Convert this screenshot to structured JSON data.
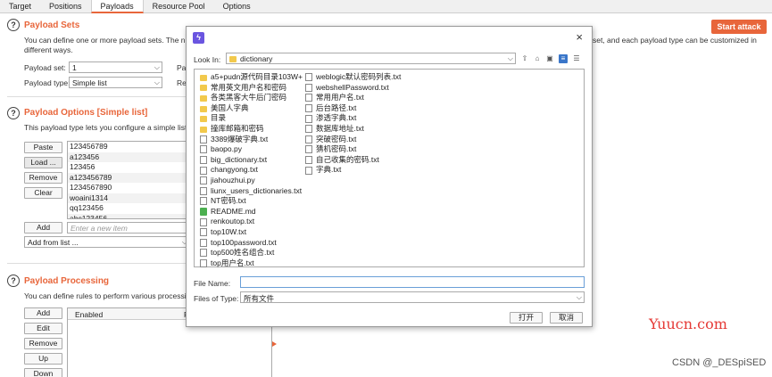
{
  "tabs": [
    "Target",
    "Positions",
    "Payloads",
    "Resource Pool",
    "Options"
  ],
  "payload_sets": {
    "title": "Payload Sets",
    "desc_line1": "You can define one or more payload sets. The numb",
    "desc_line2": "different ways.",
    "desc_right": "set, and each payload type can be customized in",
    "start_label": "Start attack",
    "set_label": "Payload set:",
    "set_value": "1",
    "type_label": "Payload type:",
    "type_value": "Simple list",
    "right_label_1": "Pay",
    "right_label_2": "Rec"
  },
  "payload_options": {
    "title": "Payload Options [Simple list]",
    "desc": "This payload type lets you configure a simple list of",
    "buttons": [
      "Paste",
      "Load ...",
      "Remove",
      "Clear"
    ],
    "items": [
      "123456789",
      "a123456",
      "123456",
      "a123456789",
      "1234567890",
      "woaini1314",
      "qq123456",
      "abc123456"
    ],
    "add_label": "Add",
    "add_placeholder": "Enter a new item",
    "add_from_list": "Add from list ..."
  },
  "payload_processing": {
    "title": "Payload Processing",
    "desc": "You can define rules to perform various processing",
    "buttons": [
      "Add",
      "Edit",
      "Remove",
      "Up",
      "Down"
    ],
    "col_enabled": "Enabled",
    "col_rule": "R"
  },
  "dialog": {
    "look_in_label": "Look In:",
    "look_in_value": "dictionary",
    "close_glyph": "×",
    "logo_glyph": "ϟ",
    "files_col1": [
      {
        "name": "a5+pudn源代码目录103W+",
        "icon": "folder"
      },
      {
        "name": "常用英文用户名和密码",
        "icon": "folder"
      },
      {
        "name": "各类黑客大牛后门密码",
        "icon": "folder"
      },
      {
        "name": "美国人字典",
        "icon": "folder"
      },
      {
        "name": "目录",
        "icon": "folder"
      },
      {
        "name": "撞库邮箱和密码",
        "icon": "folder"
      },
      {
        "name": "3389爆破字典.txt",
        "icon": "file"
      },
      {
        "name": "baopo.py",
        "icon": "file"
      },
      {
        "name": "big_dictionary.txt",
        "icon": "file"
      },
      {
        "name": "changyong.txt",
        "icon": "file"
      },
      {
        "name": "jiahouzhui.py",
        "icon": "file"
      },
      {
        "name": "liunx_users_dictionaries.txt",
        "icon": "file"
      },
      {
        "name": "NT密码.txt",
        "icon": "file"
      },
      {
        "name": "README.md",
        "icon": "md"
      },
      {
        "name": "renkoutop.txt",
        "icon": "file"
      },
      {
        "name": "top10W.txt",
        "icon": "file"
      },
      {
        "name": "top100password.txt",
        "icon": "file"
      },
      {
        "name": "top500姓名组合.txt",
        "icon": "file"
      },
      {
        "name": "top用户名.txt",
        "icon": "file"
      }
    ],
    "files_col2": [
      {
        "name": "weblogic默认密码列表.txt",
        "icon": "file"
      },
      {
        "name": "webshellPassword.txt",
        "icon": "file"
      },
      {
        "name": "常用用户名.txt",
        "icon": "file"
      },
      {
        "name": "后台路径.txt",
        "icon": "file"
      },
      {
        "name": "渗透字典.txt",
        "icon": "file"
      },
      {
        "name": "数据库地址.txt",
        "icon": "file"
      },
      {
        "name": "突破密码.txt",
        "icon": "file"
      },
      {
        "name": "猜机密码.txt",
        "icon": "file"
      },
      {
        "name": "自己收集的密码.txt",
        "icon": "file"
      },
      {
        "name": "字典.txt",
        "icon": "file"
      }
    ],
    "file_name_label": "File Name:",
    "file_name_value": "",
    "file_type_label": "Files of Type:",
    "file_type_value": "所有文件",
    "open_label": "打开",
    "cancel_label": "取消"
  },
  "watermark": {
    "site": "Yuucn.com",
    "credit": "CSDN @_DESpiSED"
  },
  "colors": {
    "accent": "#e8663b",
    "selected_view": "#3a76c9",
    "watermark_red": "#e53935"
  }
}
